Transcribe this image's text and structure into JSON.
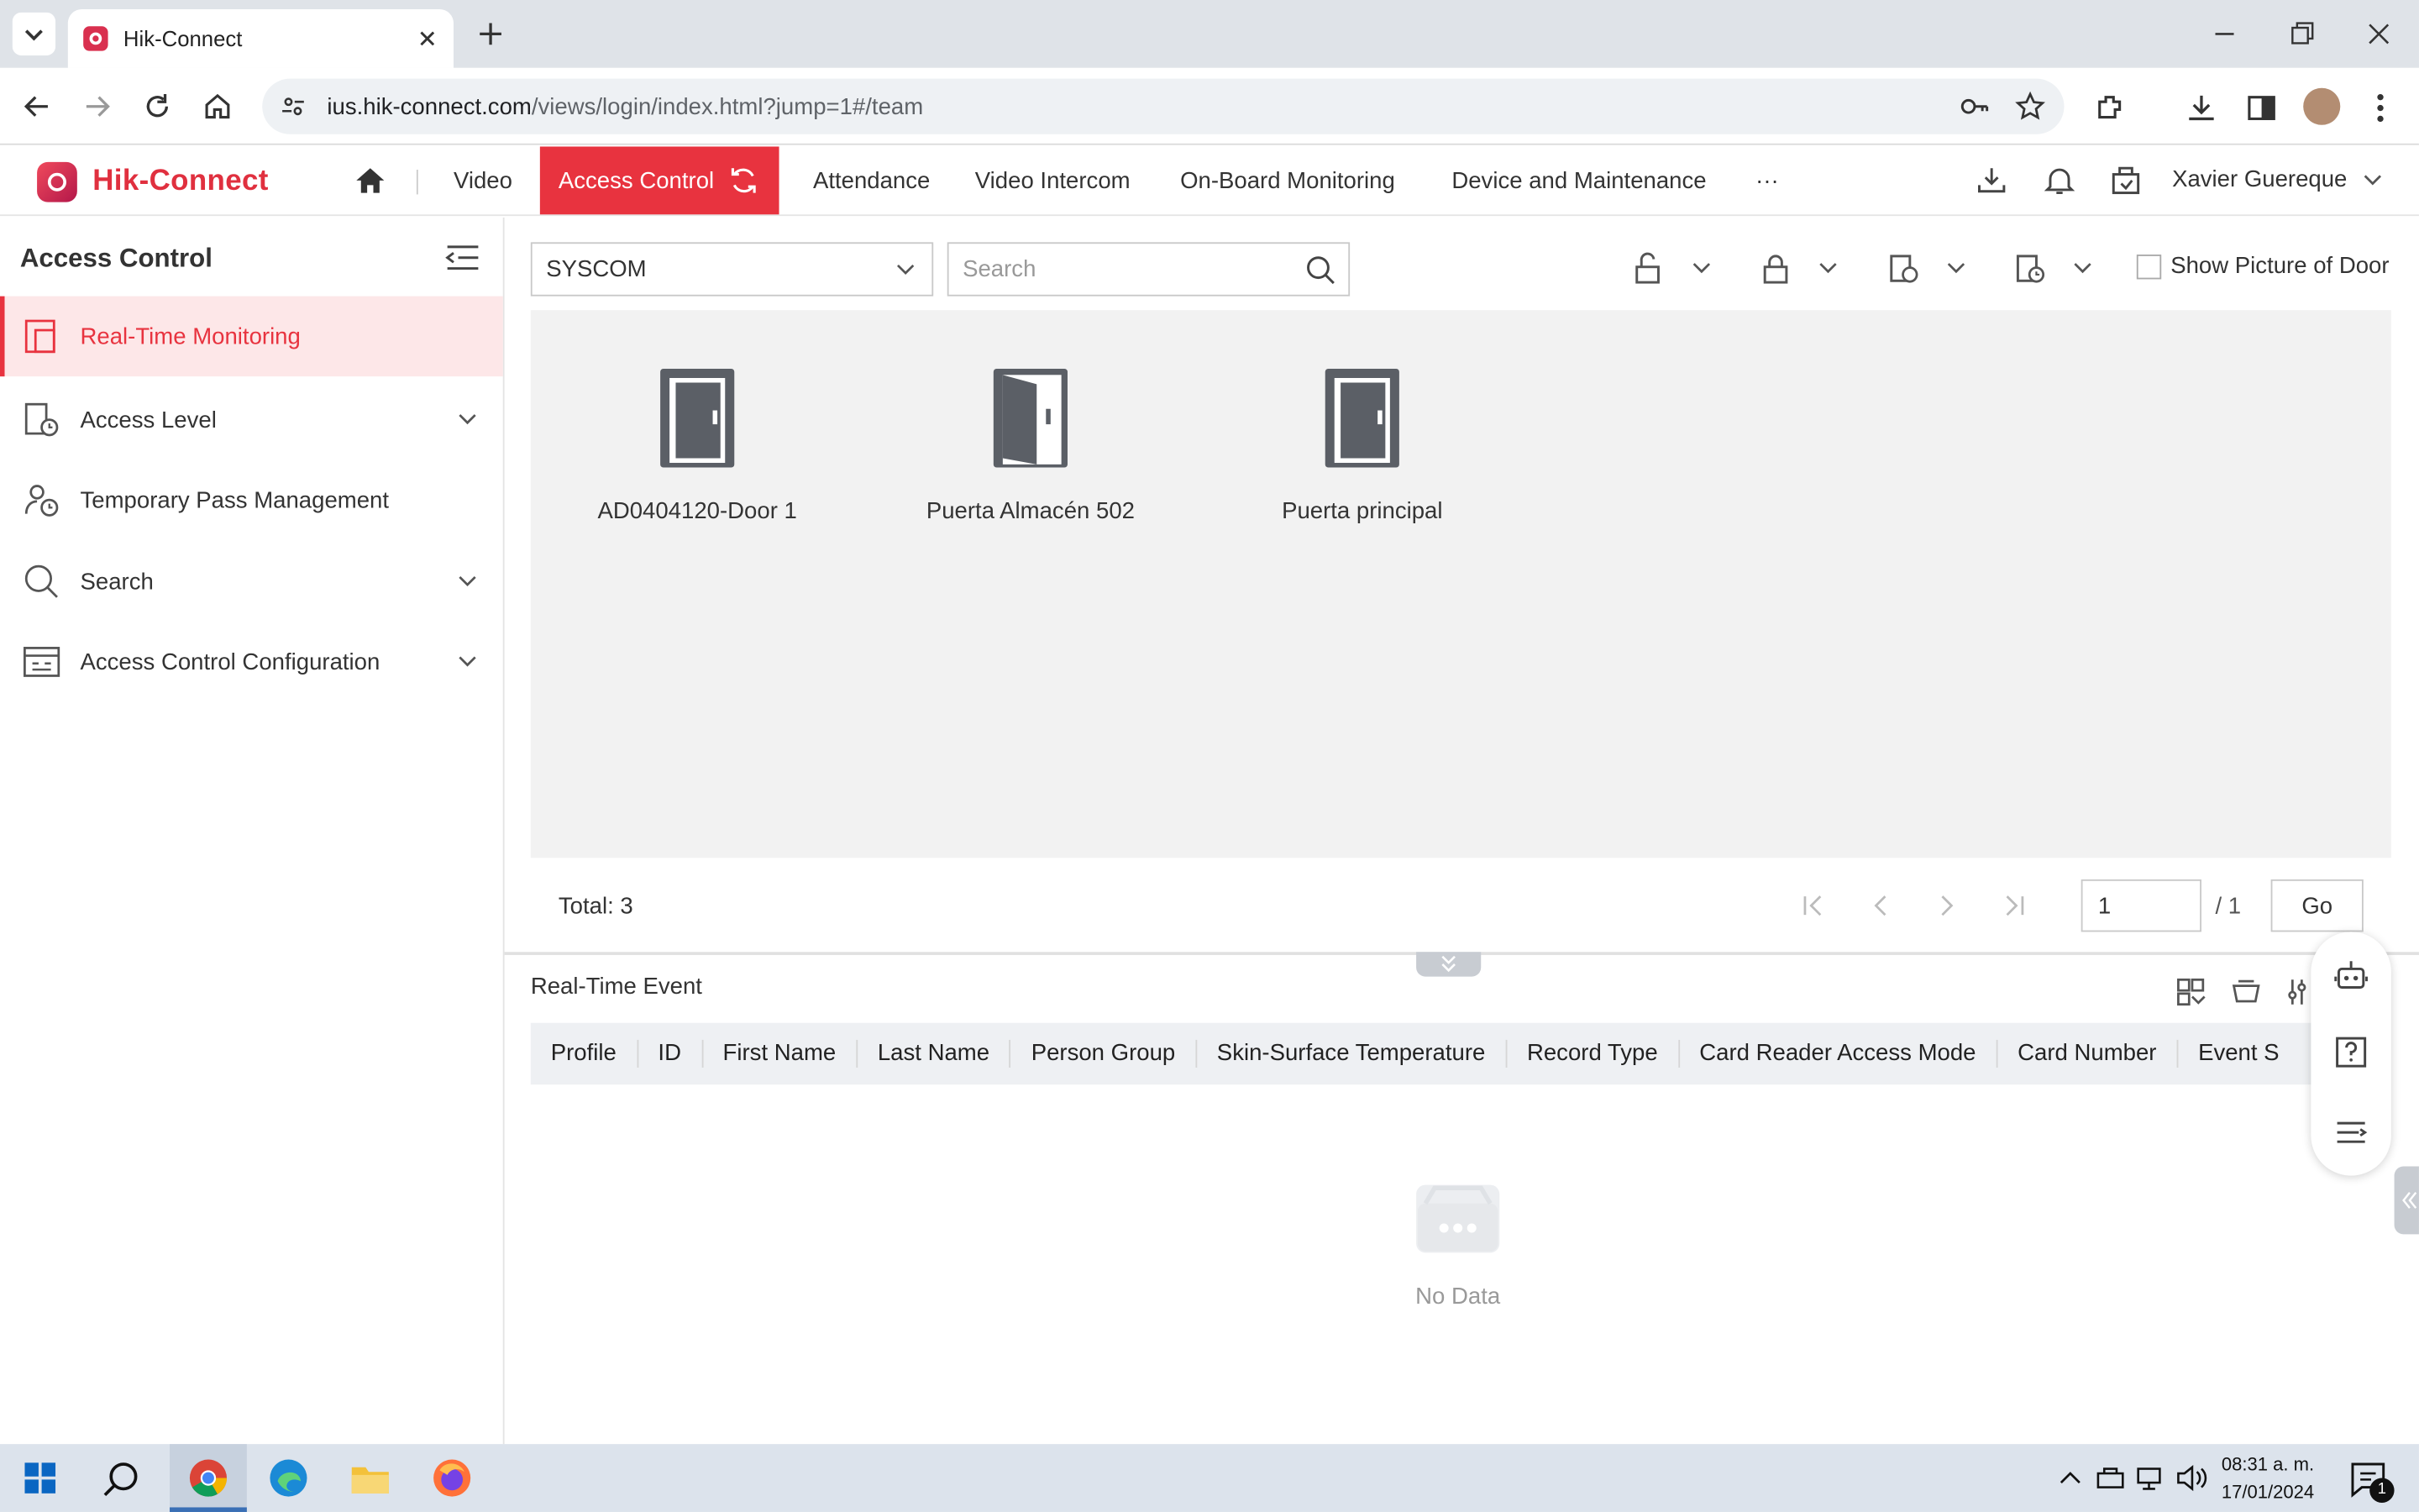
{
  "browser": {
    "tab_title": "Hik-Connect",
    "url_host": "ius.hik-connect.com",
    "url_path": "/views/login/index.html?jump=1#/team"
  },
  "app": {
    "logo_text": "Hik-Connect",
    "nav": {
      "video": "Video",
      "access_control": "Access Control",
      "attendance": "Attendance",
      "video_intercom": "Video Intercom",
      "onboard": "On-Board Monitoring",
      "device": "Device and Maintenance",
      "more": "···"
    },
    "user_name": "Xavier Guereque"
  },
  "sidebar": {
    "title": "Access Control",
    "items": [
      {
        "label": "Real-Time Monitoring",
        "icon": "monitor-icon",
        "active": true
      },
      {
        "label": "Access Level",
        "icon": "access-level-icon"
      },
      {
        "label": "Temporary Pass Management",
        "icon": "temp-pass-icon"
      },
      {
        "label": "Search",
        "icon": "search-icon"
      },
      {
        "label": "Access Control Configuration",
        "icon": "config-icon"
      }
    ]
  },
  "main": {
    "site_select": "SYSCOM",
    "search_placeholder": "Search",
    "show_picture_label": "Show Picture of Door",
    "doors": [
      {
        "name": "AD0404120-Door 1",
        "state": "closed"
      },
      {
        "name": "Puerta Almacén 502",
        "state": "open"
      },
      {
        "name": "Puerta principal",
        "state": "closed"
      }
    ],
    "total": "Total: 3",
    "page_value": "1",
    "page_of": "/ 1",
    "go": "Go"
  },
  "events": {
    "title": "Real-Time Event",
    "columns": [
      "Profile",
      "ID",
      "First Name",
      "Last Name",
      "Person Group",
      "Skin-Surface Temperature",
      "Record Type",
      "Card Reader Access Mode",
      "Card Number",
      "Event S"
    ],
    "no_data": "No Data"
  },
  "taskbar": {
    "time": "08:31 a. m.",
    "date": "17/01/2024",
    "notif_count": "1"
  },
  "colors": {
    "accent": "#e8333f",
    "sidebar_active_bg": "#fde7e8",
    "door_icon": "#5b5f66"
  }
}
